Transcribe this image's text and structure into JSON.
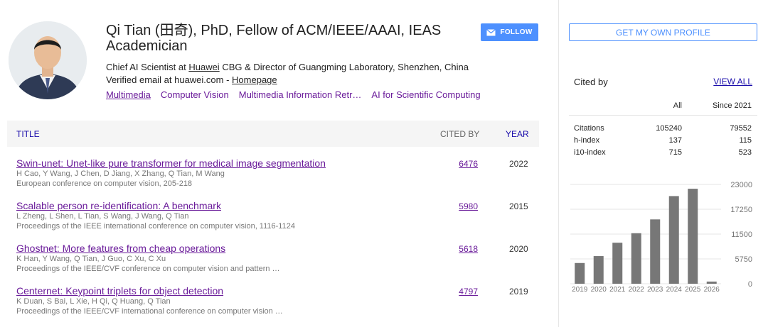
{
  "profile": {
    "name": "Qi Tian (田奇), PhD, Fellow of ACM/IEEE/AAAI, IEAS Academician",
    "affiliation_prefix": "Chief AI Scientist at ",
    "affiliation_org": "Huawei",
    "affiliation_suffix": " CBG & Director of Guangming Laboratory, Shenzhen, China",
    "email_prefix": "Verified email at huawei.com - ",
    "homepage_label": "Homepage",
    "interests": [
      "Multimedia",
      "Computer Vision",
      "Multimedia Information Retr…",
      "AI for Scientific Computing"
    ],
    "follow_label": "FOLLOW"
  },
  "table": {
    "headers": {
      "title": "TITLE",
      "cited_by": "CITED BY",
      "year": "YEAR"
    },
    "rows": [
      {
        "title": "Swin-unet: Unet-like pure transformer for medical image segmentation",
        "authors": "H Cao, Y Wang, J Chen, D Jiang, X Zhang, Q Tian, M Wang",
        "venue": "European conference on computer vision, 205-218",
        "cited": "6476",
        "year": "2022"
      },
      {
        "title": "Scalable person re-identification: A benchmark",
        "authors": "L Zheng, L Shen, L Tian, S Wang, J Wang, Q Tian",
        "venue": "Proceedings of the IEEE international conference on computer vision, 1116-1124",
        "cited": "5980",
        "year": "2015"
      },
      {
        "title": "Ghostnet: More features from cheap operations",
        "authors": "K Han, Y Wang, Q Tian, J Guo, C Xu, C Xu",
        "venue": "Proceedings of the IEEE/CVF conference on computer vision and pattern …",
        "cited": "5618",
        "year": "2020"
      },
      {
        "title": "Centernet: Keypoint triplets for object detection",
        "authors": "K Duan, S Bai, L Xie, H Qi, Q Huang, Q Tian",
        "venue": "Proceedings of the IEEE/CVF international conference on computer vision …",
        "cited": "4797",
        "year": "2019"
      }
    ]
  },
  "sidebar": {
    "profile_button": "GET MY OWN PROFILE",
    "cited_by_label": "Cited by",
    "view_all_label": "VIEW ALL",
    "col_all": "All",
    "col_since": "Since 2021",
    "stats": [
      {
        "label": "Citations",
        "all": "105240",
        "since": "79552"
      },
      {
        "label": "h-index",
        "all": "137",
        "since": "115"
      },
      {
        "label": "i10-index",
        "all": "715",
        "since": "523"
      }
    ]
  },
  "chart_data": {
    "type": "bar",
    "categories": [
      "2019",
      "2020",
      "2021",
      "2022",
      "2023",
      "2024",
      "2025",
      "2026"
    ],
    "values": [
      4800,
      6400,
      9500,
      11700,
      14900,
      20300,
      22000,
      500
    ],
    "yticks": [
      "23000",
      "17250",
      "11500",
      "5750",
      "0"
    ],
    "ylim": [
      0,
      23000
    ],
    "bar_color": "#777777",
    "grid": true
  },
  "colors": {
    "accent": "#4d90fe",
    "link": "#6a1b9a",
    "header_link": "#1a0dab"
  }
}
